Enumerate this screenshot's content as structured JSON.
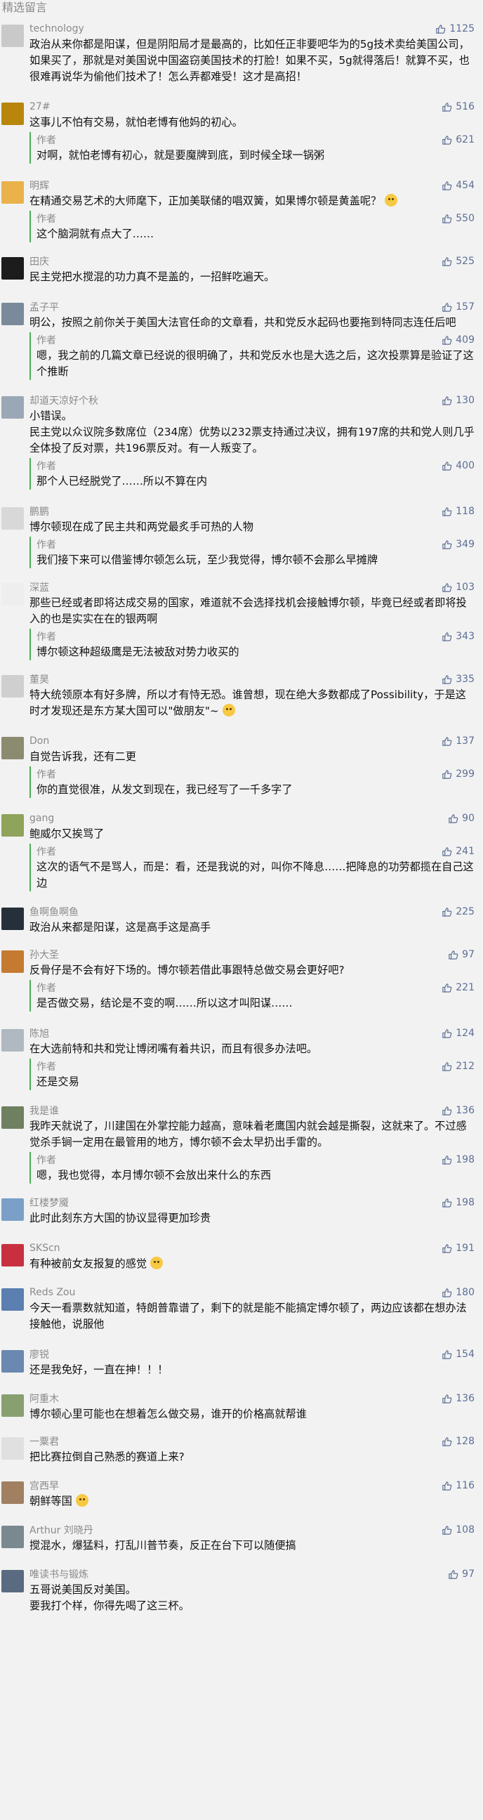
{
  "section_title": "精选留言",
  "reply_label": "作者",
  "comments": [
    {
      "name": "technology",
      "likes": "1125",
      "avatar_color": "#c9c9c9",
      "text": "政治从来你都是阳谋，但是阴阳局才是最高的，比如任正非要吧华为的5g技术卖给美国公司，如果买了，那就是对美国说中国盗窃美国技术的打脸！如果不买，5g就得落后！就算不买，也很难再说华为偷他们技术了！怎么弄都难受！这才是高招！"
    },
    {
      "name": "27#",
      "likes": "516",
      "avatar_color": "#b8860b",
      "text": "这事儿不怕有交易，就怕老博有他妈的初心。",
      "reply": {
        "likes": "621",
        "text": "对啊，就怕老博有初心，就是要魔牌到底，到时候全球一锅粥"
      }
    },
    {
      "name": "明辉",
      "likes": "454",
      "avatar_color": "#e9b24a",
      "text": "在精通交易艺术的大师麾下，正加美联储的唱双簧，如果博尔顿是黄盖呢？",
      "emoji": true,
      "reply": {
        "likes": "550",
        "text": "这个脑洞就有点大了……"
      }
    },
    {
      "name": "田庆",
      "likes": "525",
      "avatar_color": "#1c1c1c",
      "text": "民主党把水搅混的功力真不是盖的，一招鲜吃遍天。"
    },
    {
      "name": "孟子平",
      "likes": "157",
      "avatar_color": "#7a8a9a",
      "text": "明公，按照之前你关于美国大法官任命的文章看，共和党反水起码也要拖到特同志连任后吧",
      "reply": {
        "likes": "409",
        "text": "嗯，我之前的几篇文章已经说的很明确了，共和党反水也是大选之后，这次投票算是验证了这个推断"
      }
    },
    {
      "name": "却道天凉好个秋",
      "likes": "130",
      "avatar_color": "#9aa8b5",
      "text": "小错误。\n民主党以众议院多数席位（234席）优势以232票支持通过决议，拥有197席的共和党人则几乎全体投了反对票，共196票反对。有一人叛变了。",
      "reply": {
        "likes": "400",
        "text": "那个人已经脱党了……所以不算在内"
      }
    },
    {
      "name": "鹏鹏",
      "likes": "118",
      "avatar_color": "#d8d8d8",
      "text": "博尔顿现在成了民主共和两党最炙手可热的人物",
      "reply": {
        "likes": "349",
        "text": "我们接下来可以借鉴博尔顿怎么玩，至少我觉得，博尔顿不会那么早摊牌"
      }
    },
    {
      "name": "深蓝",
      "likes": "103",
      "avatar_color": "#eeeeee",
      "text": "那些已经或者即将达成交易的国家，难道就不会选择找机会接触博尔顿，毕竟已经或者即将投入的也是实实在在的银两啊",
      "reply": {
        "likes": "343",
        "text": "博尔顿这种超级鹰是无法被敌对势力收买的"
      }
    },
    {
      "name": "董昊",
      "likes": "335",
      "avatar_color": "#cfcfcf",
      "text": "特大统领原本有好多牌，所以才有恃无恐。谁曾想，现在绝大多数都成了Possibility，于是这时才发现还是东方某大国可以\"做朋友\"~",
      "emoji": true
    },
    {
      "name": "Don",
      "likes": "137",
      "avatar_color": "#8b8b70",
      "text": "自觉告诉我，还有二更",
      "reply": {
        "likes": "299",
        "text": "你的直觉很准，从发文到现在，我已经写了一千多字了"
      }
    },
    {
      "name": "gang",
      "likes": "90",
      "avatar_color": "#8fa35a",
      "text": "鲍威尔又挨骂了",
      "reply": {
        "likes": "241",
        "text": "这次的语气不是骂人，而是：看，还是我说的对，叫你不降息……把降息的功劳都揽在自己这边"
      }
    },
    {
      "name": "鱼啊鱼啊鱼",
      "likes": "225",
      "avatar_color": "#26303a",
      "text": "政治从来都是阳谋，这是高手这是高手"
    },
    {
      "name": "孙大圣",
      "likes": "97",
      "avatar_color": "#c47a30",
      "text": "反骨仔是不会有好下场的。博尔顿若借此事跟特总做交易会更好吧?",
      "reply": {
        "likes": "221",
        "text": "是否做交易，结论是不变的啊……所以这才叫阳谋……"
      }
    },
    {
      "name": "陈旭",
      "likes": "124",
      "avatar_color": "#b0b8c0",
      "text": "在大选前特和共和党让博闭嘴有着共识，而且有很多办法吧。",
      "reply": {
        "likes": "212",
        "text": "还是交易"
      }
    },
    {
      "name": "我是谁",
      "likes": "136",
      "avatar_color": "#6f8060",
      "text": "我昨天就说了，川建国在外掌控能力越高，意味着老鹰国内就会越是撕裂，这就来了。不过感觉杀手锏一定用在最管用的地方，博尔顿不会太早扔出手雷的。",
      "reply": {
        "likes": "198",
        "text": "嗯，我也觉得，本月博尔顿不会放出来什么的东西"
      }
    },
    {
      "name": "红楼梦魇",
      "likes": "198",
      "avatar_color": "#7aa0c8",
      "text": "此时此刻东方大国的协议显得更加珍贵"
    },
    {
      "name": "SKScn",
      "likes": "191",
      "avatar_color": "#c83040",
      "text": "有种被前女友报复的感觉",
      "emoji": true
    },
    {
      "name": "Reds Zou",
      "likes": "180",
      "avatar_color": "#5a7fb0",
      "text": "今天一看票数就知道，特朗普靠谱了，剩下的就是能不能搞定博尔顿了，两边应该都在想办法接触他，说服他"
    },
    {
      "name": "廖锐",
      "likes": "154",
      "avatar_color": "#6a88b0",
      "text": "还是我免好，一直在抻！！！"
    },
    {
      "name": "阿重木",
      "likes": "136",
      "avatar_color": "#88a070",
      "text": "博尔顿心里可能也在想着怎么做交易，谁开的价格高就帮谁"
    },
    {
      "name": "一粟君",
      "likes": "128",
      "avatar_color": "#e0e0e0",
      "text": "把比赛拉倒自己熟悉的赛道上来?"
    },
    {
      "name": "宫西早",
      "likes": "116",
      "avatar_color": "#a08060",
      "text": "朝鲜等国",
      "emoji": true
    },
    {
      "name": "Arthur 刘晓丹",
      "likes": "108",
      "avatar_color": "#7a8890",
      "text": "搅混水，爆猛料，打乱川普节奏，反正在台下可以随便搞"
    },
    {
      "name": "唯读书与锻炼",
      "likes": "97",
      "avatar_color": "#5a6a80",
      "text": "五哥说美国反对美国。\n要我打个样，你得先喝了这三杯。"
    }
  ]
}
